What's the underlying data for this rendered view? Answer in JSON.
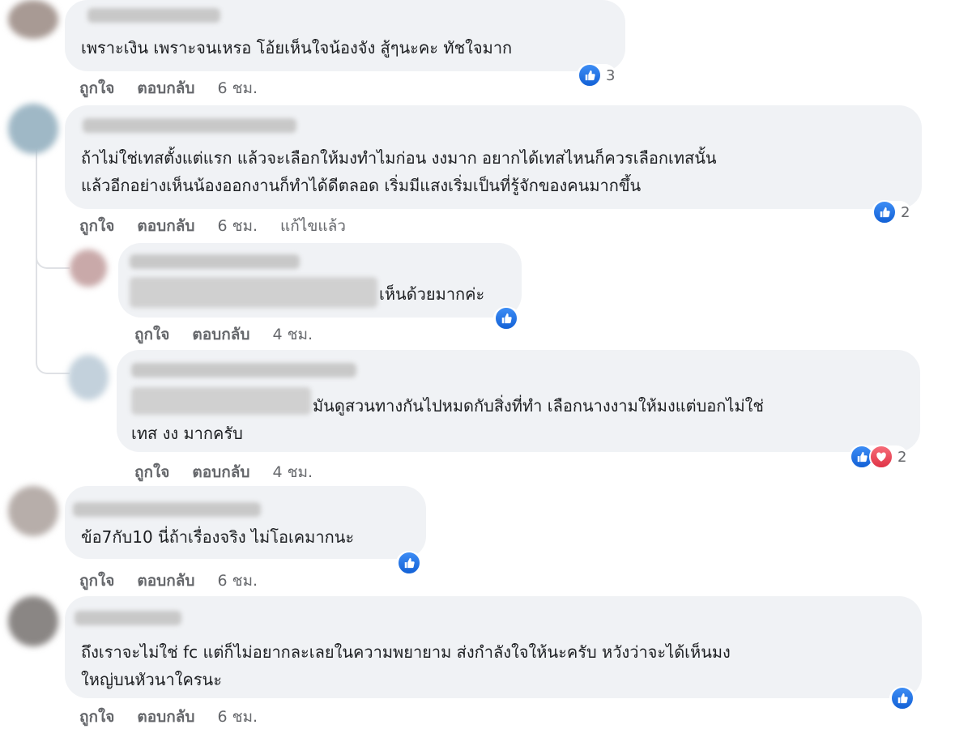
{
  "comments": [
    {
      "text": "เพราะเงิน เพราะจนเหรอ โอ้ยเห็นใจน้องจัง สู้ๆนะคะ ทัชใจมาก",
      "like_label": "ถูกใจ",
      "reply_label": "ตอบกลับ",
      "time": "6 ชม.",
      "reaction_count": "3"
    },
    {
      "text": "ถ้าไม่ใช่เทสตั้งแต่แรก แล้วจะเลือกให้มงทำไมก่อน งงมาก อยากได้เทสไหนก็ควรเลือกเทสนั้น\nแล้วอีกอย่างเห็นน้องออกงานก็ทำได้ดีตลอด เริ่มมีแสงเริ่มเป็นที่รู้จักของคนมากขึ้น",
      "like_label": "ถูกใจ",
      "reply_label": "ตอบกลับ",
      "time": "6 ชม.",
      "edited_label": "แก้ไขแล้ว",
      "reaction_count": "2"
    },
    {
      "text": "เห็นด้วยมากค่ะ",
      "like_label": "ถูกใจ",
      "reply_label": "ตอบกลับ",
      "time": "4 ชม."
    },
    {
      "text": "มันดูสวนทางกันไปหมดกับสิ่งที่ทำ เลือกนางงามให้มงแต่บอกไม่ใช่",
      "text_line2": "เทส งง มากครับ",
      "like_label": "ถูกใจ",
      "reply_label": "ตอบกลับ",
      "time": "4 ชม.",
      "reaction_count": "2"
    },
    {
      "text": "ข้อ7กับ10 นี่ถ้าเรื่องจริง ไม่โอเคมากนะ",
      "like_label": "ถูกใจ",
      "reply_label": "ตอบกลับ",
      "time": "6 ชม."
    },
    {
      "text": "ถึงเราจะไม่ใช่ fc แต่ก็ไม่อยากละเลยในความพยายาม ส่งกำลังใจให้นะครับ หวังว่าจะได้เห็นมง\nใหญ่บนหัวนาใครนะ",
      "like_label": "ถูกใจ",
      "reply_label": "ตอบกลับ",
      "time": "6 ชม."
    }
  ],
  "icons": {
    "like": "thumbs-up-icon",
    "love": "heart-icon"
  },
  "colors": {
    "like_blue": "#1877f2",
    "love_red": "#e03347",
    "bubble_bg": "#f0f2f5",
    "meta_gray": "#65676b"
  }
}
